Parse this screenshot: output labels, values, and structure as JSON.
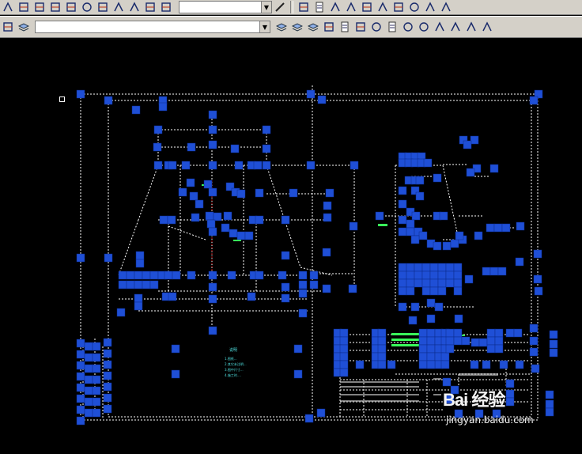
{
  "toolbar_top": {
    "left_icons": [
      "arc-icon",
      "dimension-linear-icon",
      "dimension-continue-icon",
      "dimension-ordinate-icon",
      "dimension-edit-icon",
      "center-mark-icon",
      "tolerance-icon",
      "leader-icon",
      "text-style-icon",
      "dimension-style-icon",
      "dimension-update-icon"
    ],
    "dimstyle_combo_value": "",
    "right_icons": [
      "match-properties-icon",
      "properties-icon",
      "polyline-edit-icon",
      "trim-icon",
      "explode-icon",
      "block-icon",
      "group-icon",
      "point-icon",
      "fillet-icon",
      "corner-icon"
    ]
  },
  "toolbar_second": {
    "left_icons": [
      "block-insert-icon",
      "layers-icon"
    ],
    "layer_combo_value": "",
    "right_icons": [
      "layer-previous-icon",
      "layer-states-icon",
      "layer-manager-icon",
      "new-icon",
      "open-icon",
      "save-icon",
      "print-icon",
      "preview-icon",
      "publish-icon",
      "plot-icon",
      "pencil-icon",
      "match-brush-icon",
      "undo-icon",
      "redo-icon"
    ]
  },
  "drawing": {
    "annotation_title": "说明",
    "annotation_lines": [
      "1.图纸...",
      "2.其它未注明...",
      "3.图中尺寸...",
      "4.施工时...."
    ]
  },
  "watermark": {
    "logo_text": "Bai 经验",
    "url_text": "jingyan.baidu.com"
  },
  "colors": {
    "background": "#000000",
    "grip": "#1f4fd6",
    "dashed_line": "#ffffff",
    "green_text": "#39ff5a",
    "cyan_text": "#4fe0e0",
    "toolbar": "#d4d0c8"
  }
}
